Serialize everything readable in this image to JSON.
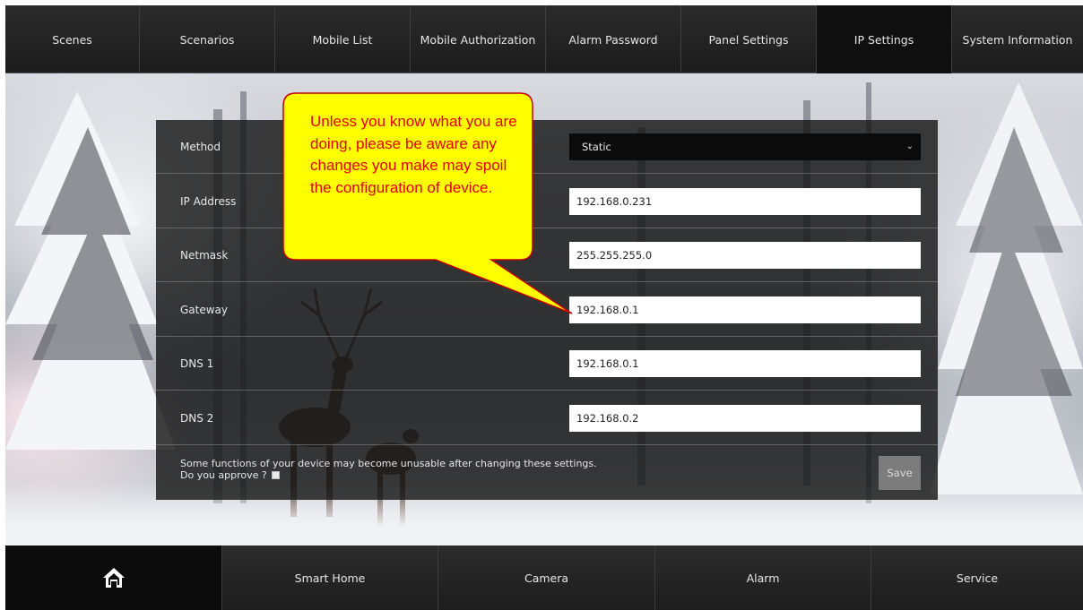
{
  "top_nav": {
    "tabs": [
      {
        "label": "Scenes",
        "active": false
      },
      {
        "label": "Scenarios",
        "active": false
      },
      {
        "label": "Mobile List",
        "active": false
      },
      {
        "label": "Mobile Authorization",
        "active": false
      },
      {
        "label": "Alarm Password",
        "active": false
      },
      {
        "label": "Panel Settings",
        "active": false
      },
      {
        "label": "IP Settings",
        "active": true
      },
      {
        "label": "System Information",
        "active": false
      }
    ]
  },
  "ip_settings": {
    "method": {
      "label": "Method",
      "value": "Static",
      "icon": "chevron-down-icon"
    },
    "ip_address": {
      "label": "IP Address",
      "value": "192.168.0.231"
    },
    "netmask": {
      "label": "Netmask",
      "value": "255.255.255.0"
    },
    "gateway": {
      "label": "Gateway",
      "value": "192.168.0.1"
    },
    "dns1": {
      "label": "DNS 1",
      "value": "192.168.0.1"
    },
    "dns2": {
      "label": "DNS 2",
      "value": "192.168.0.2"
    },
    "warning_line1": "Some functions of your device may become unusable after changing these settings.",
    "warning_line2": "Do you approve ?",
    "approve_checked": false,
    "save_label": "Save"
  },
  "callout": {
    "text": "Unless you know what you are doing, please be aware any changes you make may spoil the configuration of device.",
    "text_color": "#e10000",
    "fill_color": "#ffff00"
  },
  "bottom_nav": {
    "home_icon": "home-icon",
    "items": [
      "Smart Home",
      "Camera",
      "Alarm",
      "Service"
    ]
  }
}
